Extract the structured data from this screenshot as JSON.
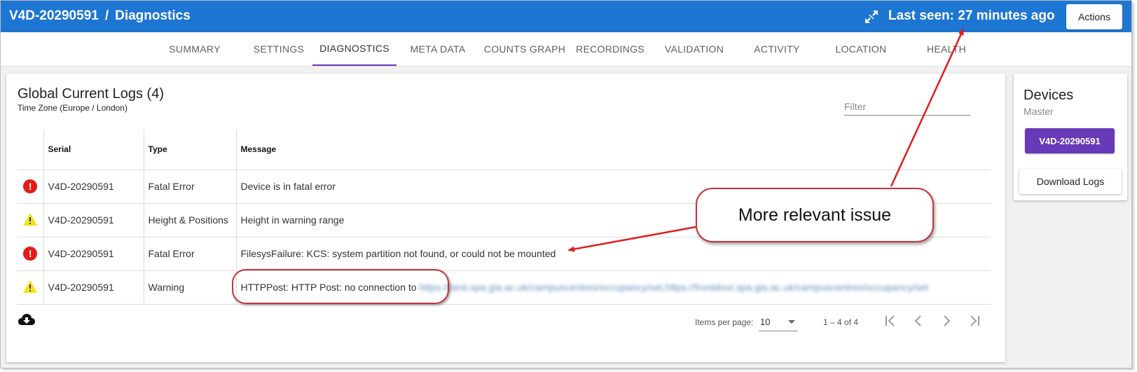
{
  "header": {
    "device_id": "V4D-20290591",
    "separator": "/",
    "page": "Diagnostics",
    "last_seen": "Last seen: 27 minutes ago",
    "actions_label": "Actions"
  },
  "tabs": [
    {
      "label": "SUMMARY",
      "active": false
    },
    {
      "label": "SETTINGS",
      "active": false
    },
    {
      "label": "DIAGNOSTICS",
      "active": true
    },
    {
      "label": "META DATA",
      "active": false
    },
    {
      "label": "COUNTS GRAPH",
      "active": false
    },
    {
      "label": "RECORDINGS",
      "active": false
    },
    {
      "label": "VALIDATION",
      "active": false
    },
    {
      "label": "ACTIVITY",
      "active": false
    },
    {
      "label": "LOCATION",
      "active": false
    },
    {
      "label": "HEALTH",
      "active": false
    }
  ],
  "logs": {
    "title": "Global Current Logs (4)",
    "timezone": "Time Zone (Europe / London)",
    "filter_placeholder": "Filter",
    "columns": {
      "serial": "Serial",
      "type": "Type",
      "message": "Message"
    },
    "rows": [
      {
        "icon": "error-icon",
        "serial": "V4D-20290591",
        "type": "Fatal Error",
        "message": "Device is in fatal error",
        "redacted": ""
      },
      {
        "icon": "warning-icon",
        "serial": "V4D-20290591",
        "type": "Height & Positions",
        "message": "Height in warning range",
        "redacted": ""
      },
      {
        "icon": "error-icon",
        "serial": "V4D-20290591",
        "type": "Fatal Error",
        "message": "FilesysFailure: KCS: system partition not found, or could not be mounted",
        "redacted": ""
      },
      {
        "icon": "warning-icon",
        "serial": "V4D-20290591",
        "type": "Warning",
        "message": "HTTPPost: HTTP Post: no connection to",
        "redacted": "https://ttest.spa.gla.ac.uk/campuscentres/occupancy/set,https://frontdoor.spa.gla.ac.uk/campuscentres/occupancy/set"
      }
    ],
    "pagination": {
      "items_per_page_label": "Items per page:",
      "items_per_page": "10",
      "range": "1 – 4 of 4"
    }
  },
  "devices": {
    "title": "Devices",
    "subtitle": "Master",
    "device_button": "V4D-20290591",
    "download_label": "Download Logs"
  },
  "annotation": {
    "callout_text": "More relevant issue",
    "color": "#e31b1b"
  },
  "colors": {
    "appbar": "#1d76d2",
    "accent": "#673ab7",
    "error": "#e31b1b",
    "warning": "#f2e21a"
  }
}
